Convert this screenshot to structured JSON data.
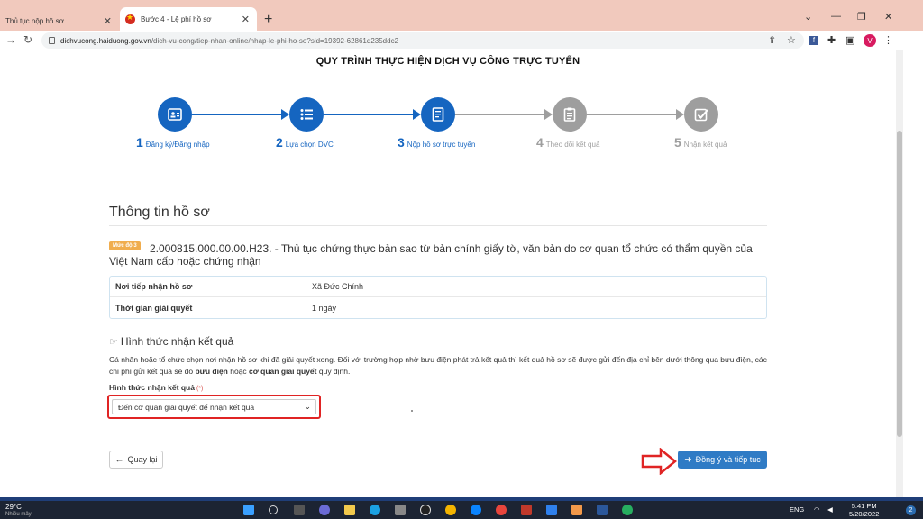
{
  "browser": {
    "tabs": [
      {
        "title": "Thủ tục nộp hồ sơ",
        "active": false
      },
      {
        "title": "Bước 4 - Lệ phí hồ sơ",
        "active": true
      }
    ],
    "url_host": "dichvucong.haiduong.gov.vn",
    "url_path": "/dich-vu-cong/tiep-nhan-online/nhap-le-phi-ho-so?sid=19392-62861d235ddc2",
    "profile_initial": "V"
  },
  "page": {
    "process_title": "QUY TRÌNH THỰC HIỆN DỊCH VỤ CÔNG TRỰC TUYẾN",
    "steps": [
      {
        "num": "1",
        "label": "Đăng ký/Đăng nhập",
        "icon": "id-card-icon",
        "done": true
      },
      {
        "num": "2",
        "label": "Lựa chọn DVC",
        "icon": "list-icon",
        "done": true
      },
      {
        "num": "3",
        "label": "Nộp hồ sơ trực tuyến",
        "icon": "document-icon",
        "done": true
      },
      {
        "num": "4",
        "label": "Theo dõi kết quả",
        "icon": "clipboard-icon",
        "done": false
      },
      {
        "num": "5",
        "label": "Nhận kết quả",
        "icon": "checkbox-icon",
        "done": false
      }
    ],
    "section_title": "Thông tin hồ sơ",
    "level_badge": "Mức độ 3",
    "procedure_code": "2.000815.000.00.00.H23.",
    "procedure_name": " - Thủ tục chứng thực bản sao từ bản chính giấy tờ, văn bản do cơ quan tổ chức có thẩm quyền của Việt Nam cấp hoặc chứng nhận",
    "info": [
      {
        "key": "Nơi tiếp nhận hồ sơ",
        "value": "Xã Đức Chính"
      },
      {
        "key": "Thời gian giải quyết",
        "value": "1 ngày"
      }
    ],
    "receive_title": "Hình thức nhận kết quả",
    "receive_note_1": "Cá nhân hoặc tổ chức chọn nơi nhận hồ sơ khi đã giải quyết xong. Đối với trường hợp nhờ bưu điện phát trả kết quả thì kết quả hồ sơ sẽ được gửi đến địa chỉ bên dưới thông qua bưu điện, các chi phí gửi kết quả sẽ do ",
    "receive_note_b1": "bưu điện",
    "receive_note_2": " hoặc ",
    "receive_note_b2": "cơ quan giải quyết",
    "receive_note_3": " quy định.",
    "field_label": "Hình thức nhận kết quả",
    "required_mark": "(*)",
    "select_value": "Đến cơ quan giải quyết để nhận kết quả",
    "back_label": "Quay lại",
    "next_label": "Đồng ý và tiếp tục"
  },
  "taskbar": {
    "temperature": "29°C",
    "weather_sub": "Nhiều mây",
    "lang": "ENG",
    "time": "5:41 PM",
    "date": "5/20/2022",
    "notifications": "2"
  },
  "colors": {
    "step_active": "#1565c0",
    "step_inactive": "#9e9e9e",
    "primary_button": "#2f7bc5",
    "highlight_red": "#e02424",
    "tab_bar": "#f1c9bd"
  }
}
